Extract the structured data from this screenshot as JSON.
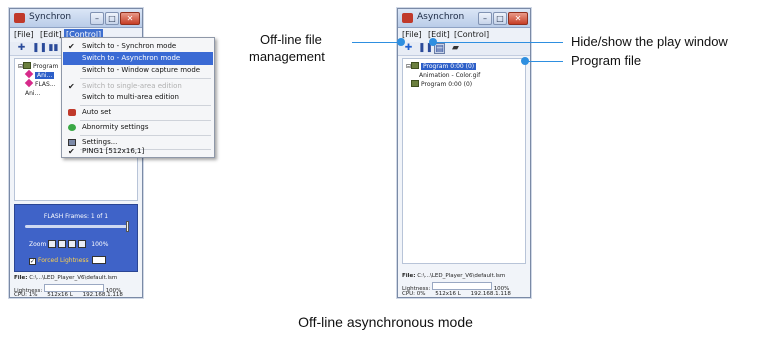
{
  "synchron_window": {
    "title": "Synchron",
    "menu": [
      "[File]",
      "[Edit]",
      "[Control]"
    ],
    "tree": [
      {
        "label": "Program"
      },
      {
        "label": "Ani..."
      },
      {
        "label": "FLAS..."
      },
      {
        "label": "Ani..."
      }
    ],
    "frames_label": "FLASH Frames: 1 of 1",
    "zoom_label": "Zoom",
    "zoom_percent": "100%",
    "check_label": "Forced Lightness",
    "file_label": "File:",
    "file_value": "C:\\...\\LED_Player_V6\\default.lsm",
    "lightness_label": "Lightness:",
    "lightness_value": "100%",
    "cpu": "CPU: 1%",
    "resolution": "512x16 L",
    "ip": "192.168.1.118"
  },
  "control_menu": {
    "items": [
      {
        "label": "Switch to - Synchron mode",
        "mark": "✔"
      },
      {
        "label": "Switch to - Asynchron mode",
        "mark": ""
      },
      {
        "label": "Switch to - Window capture mode",
        "mark": ""
      },
      {
        "label": "Switch to single-area edition",
        "mark": "✔"
      },
      {
        "label": "Switch to multi-area edition",
        "mark": ""
      },
      {
        "label": "Auto set",
        "mark": ""
      },
      {
        "label": "Abnormity settings",
        "mark": ""
      },
      {
        "label": "Settings...",
        "mark": ""
      },
      {
        "label": "PING1   [512x16,1]",
        "mark": "✔"
      }
    ]
  },
  "asynchron_window": {
    "title": "Asynchron",
    "menu": [
      "[File]",
      "[Edit]",
      "[Control]"
    ],
    "tree": [
      {
        "label": "Program 0:00 (0)"
      },
      {
        "label": "Animation - Color.gif"
      },
      {
        "label": "Program 0:00 (0)"
      }
    ],
    "file_label": "File:",
    "file_value": "C:\\...\\LED_Player_V6\\default.lsm",
    "lightness_label": "Lightness:",
    "lightness_value": "100%",
    "cpu": "CPU: 0%",
    "resolution": "512x16 L",
    "ip": "192.168.1.118"
  },
  "callouts": {
    "offline_file": "Off-line file\nmanagement",
    "offline_file_line1": "Off-line file",
    "offline_file_line2": "management",
    "hide_show": "Hide/show the play window",
    "program_file": "Program file"
  },
  "caption": "Off-line asynchronous mode",
  "colors": {
    "callout_blue": "#2e8fe0",
    "panel_blue": "#3f63c8",
    "highlight_blue": "#3a6ad4"
  }
}
